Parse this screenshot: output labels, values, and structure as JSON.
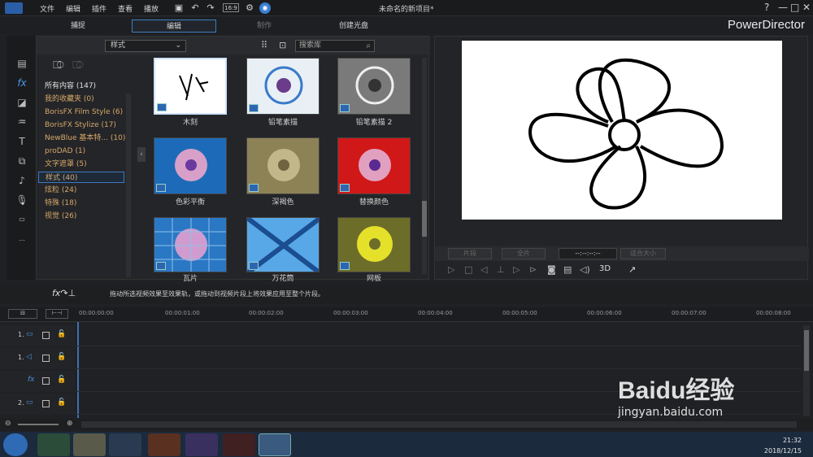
{
  "menu": [
    "文件",
    "编辑",
    "插件",
    "查看",
    "播放"
  ],
  "doc_title": "未命名的新项目*",
  "window_controls": [
    "?",
    "—",
    "□",
    "✕"
  ],
  "modes": [
    "捕捉",
    "编辑",
    "制作",
    "创建光盘"
  ],
  "brand": "PowerDirector",
  "library": {
    "dropdown": "样式",
    "search_placeholder": "搜索库",
    "categories": [
      "所有内容 (147)",
      "我的收藏夹 (0)",
      "BorisFX Film Style (6)",
      "BorisFX Stylize (17)",
      "NewBlue 基本特... (10)",
      "proDAD (1)",
      "文字遮罩 (5)",
      "样式 (40)",
      "炫粒 (24)",
      "特殊 (18)",
      "视觉 (26)"
    ],
    "effects": [
      "木刻",
      "铅笔素描",
      "铅笔素描 2",
      "色彩平衡",
      "深褐色",
      "替换颜色",
      "瓦片",
      "万花筒",
      "网板"
    ]
  },
  "preview": {
    "ctrl_labels": [
      "片段",
      "全片",
      "--:--:--:--",
      "适合大小"
    ],
    "mode_3d": "3D"
  },
  "timeline": {
    "hint": "拖动所选视频效果至效果轨，或拖动到视频片段上将效果应用至整个片段。",
    "ticks": [
      "00:00:00:00",
      "00:00:01:00",
      "00:00:02:00",
      "00:00:03:00",
      "00:00:04:00",
      "00:00:05:00",
      "00:00:06:00",
      "00:00:07:00",
      "00:00:08:00"
    ],
    "tracks": [
      {
        "num": "1."
      },
      {
        "num": "1."
      },
      {
        "num": "fx"
      },
      {
        "num": "2."
      }
    ]
  },
  "clock": {
    "time": "21:32",
    "date": "2018/12/15"
  },
  "watermark": {
    "brand": "Baidu经验",
    "url": "jingyan.baidu.com"
  }
}
